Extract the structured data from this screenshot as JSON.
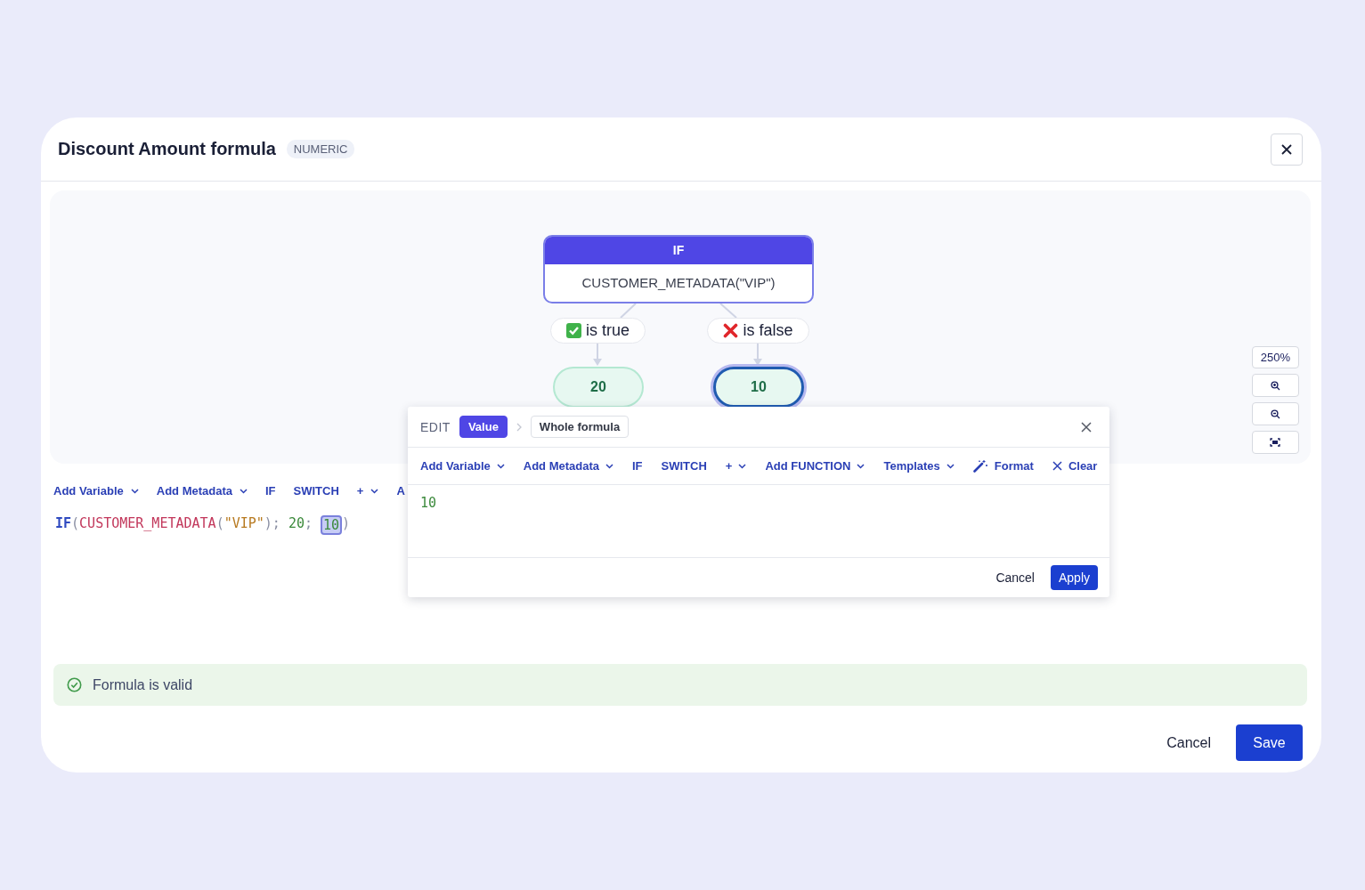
{
  "dialog": {
    "title": "Discount Amount formula",
    "type_badge": "NUMERIC"
  },
  "diagram": {
    "if_node": {
      "header": "IF",
      "condition": "CUSTOMER_METADATA(\"VIP\")"
    },
    "branches": [
      {
        "kind": "true",
        "label": "is true",
        "value": "20",
        "selected": false
      },
      {
        "kind": "false",
        "label": "is false",
        "value": "10",
        "selected": true
      }
    ]
  },
  "zoom": {
    "reading": "250%"
  },
  "toolbar": [
    {
      "label": "Add Variable",
      "kind": "dropdown"
    },
    {
      "label": "Add Metadata",
      "kind": "dropdown"
    },
    {
      "label": "IF",
      "kind": "plain"
    },
    {
      "label": "SWITCH",
      "kind": "plain"
    },
    {
      "label": "+",
      "kind": "dropdown"
    },
    {
      "label": "A",
      "kind": "plain"
    }
  ],
  "formula": [
    {
      "text": "IF",
      "kind": "keyword",
      "selected": false
    },
    {
      "text": "(",
      "kind": "punct",
      "selected": false
    },
    {
      "text": "CUSTOMER_METADATA",
      "kind": "function",
      "selected": false
    },
    {
      "text": "(",
      "kind": "punct",
      "selected": false
    },
    {
      "text": "\"VIP\"",
      "kind": "string",
      "selected": false
    },
    {
      "text": ");",
      "kind": "punct",
      "selected": false
    },
    {
      "text": " 20",
      "kind": "number",
      "selected": false
    },
    {
      "text": "; ",
      "kind": "punct",
      "selected": false
    },
    {
      "text": "10",
      "kind": "number",
      "selected": true
    },
    {
      "text": ")",
      "kind": "punct",
      "selected": false
    }
  ],
  "edit_popover": {
    "label": "EDIT",
    "breadcrumbs": [
      {
        "label": "Value",
        "selected": true
      },
      {
        "label": "Whole formula",
        "selected": false
      }
    ],
    "toolbar": [
      {
        "label": "Add Variable",
        "kind": "dropdown"
      },
      {
        "label": "Add Metadata",
        "kind": "dropdown"
      },
      {
        "label": "IF",
        "kind": "plain"
      },
      {
        "label": "SWITCH",
        "kind": "plain"
      },
      {
        "label": "+",
        "kind": "dropdown"
      },
      {
        "label": "Add FUNCTION",
        "kind": "dropdown"
      },
      {
        "label": "Templates",
        "kind": "dropdown"
      },
      {
        "label": "Format",
        "kind": "format"
      },
      {
        "label": "Clear",
        "kind": "clear"
      }
    ],
    "value": "10",
    "cancel": "Cancel",
    "apply": "Apply"
  },
  "validation": {
    "message": "Formula is valid"
  },
  "footer": {
    "cancel": "Cancel",
    "save": "Save"
  }
}
